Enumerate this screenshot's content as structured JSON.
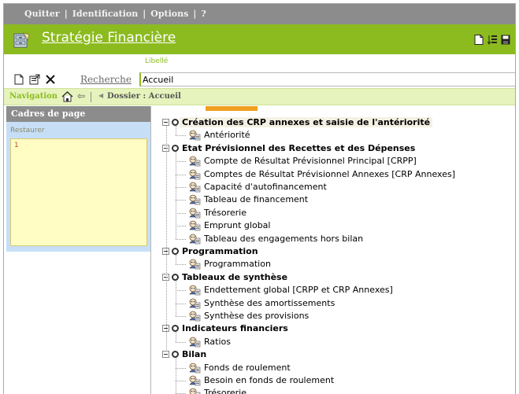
{
  "topbar": {
    "items": [
      "Quitter",
      "Identification",
      "Options",
      "?"
    ],
    "separator": "|"
  },
  "title": "Stratégie Financière",
  "toolbar": {
    "libelle_label": "Libellé",
    "recherche_label": "Recherche",
    "libelle_value": "Accueil"
  },
  "navigation": {
    "label": "Navigation",
    "dossier": "Dossier : Accueil"
  },
  "left_panel": {
    "header": "Cadres de page",
    "restore_link": "Restaurer",
    "content": "1"
  },
  "tree": [
    {
      "label": "Création des CRP annexes et saisie de l'antériorité",
      "items": [
        "Antériorité"
      ]
    },
    {
      "label": "Etat Prévisionnel des Recettes et des Dépenses",
      "items": [
        "Compte de Résultat Prévisionnel Principal [CRPP]",
        "Comptes de Résultat Prévisionnel Annexes [CRP Annexes]",
        "Capacité d'autofinancement",
        "Tableau de financement",
        "Trésorerie",
        "Emprunt global",
        "Tableau des engagements hors bilan"
      ]
    },
    {
      "label": "Programmation",
      "items": [
        "Programmation"
      ]
    },
    {
      "label": "Tableaux de synthèse",
      "items": [
        "Endettement global [CRPP et CRP Annexes]",
        "Synthèse des amortissements",
        "Synthèse des provisions"
      ]
    },
    {
      "label": "Indicateurs financiers",
      "items": [
        "Ratios"
      ]
    },
    {
      "label": "Bilan",
      "items": [
        "Fonds de roulement",
        "Besoin en fonds de roulement",
        "Trésorerie"
      ]
    }
  ],
  "colors": {
    "accent_green": "#8cbb1f",
    "menu_gray": "#8c8c8c",
    "panel_blue": "#c6dff7",
    "note_yellow": "#fffcc4"
  }
}
